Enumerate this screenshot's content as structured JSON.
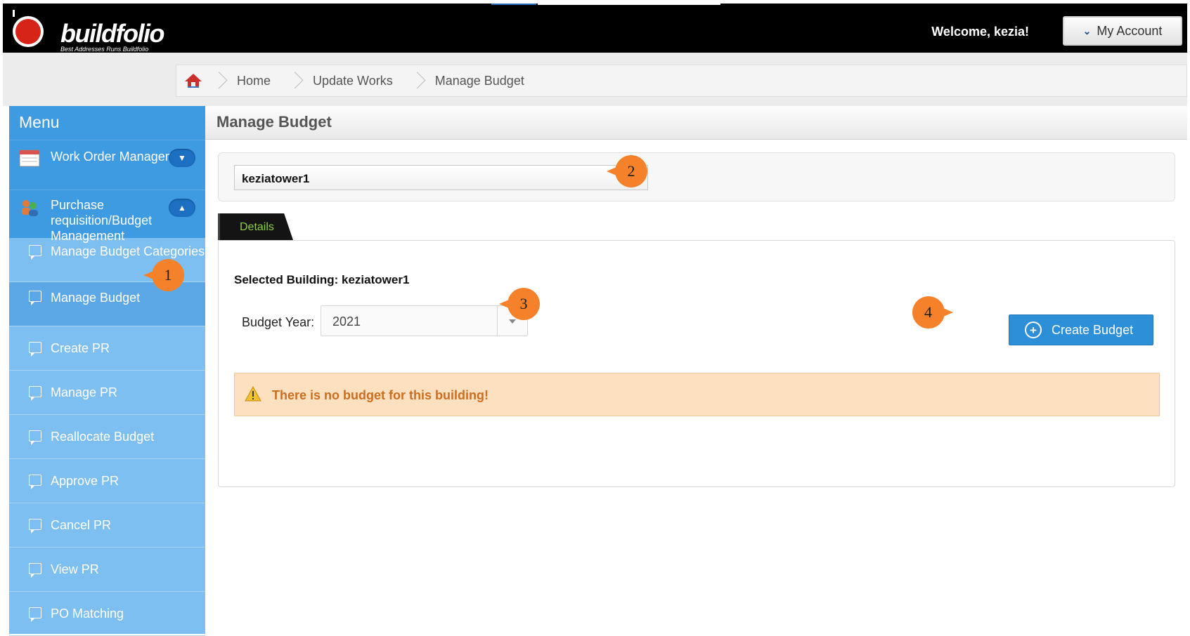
{
  "header": {
    "brand": "buildfolio",
    "tagline": "Best Addresses Runs Buildfolio",
    "welcome": "Welcome, kezia!",
    "account_button": "My Account"
  },
  "breadcrumb": {
    "items": [
      "Home",
      "Update Works",
      "Manage Budget"
    ]
  },
  "sidebar": {
    "title": "Menu",
    "groups": [
      {
        "label": "Work Order Management",
        "expanded": false
      },
      {
        "label": "Purchase requisition/Budget Management",
        "expanded": true
      }
    ],
    "items": [
      {
        "label": "Manage Budget Categories"
      },
      {
        "label": "Manage Budget",
        "active": true
      },
      {
        "label": "Create PR"
      },
      {
        "label": "Manage PR"
      },
      {
        "label": "Reallocate Budget"
      },
      {
        "label": "Approve PR"
      },
      {
        "label": "Cancel PR"
      },
      {
        "label": "View PR"
      },
      {
        "label": "PO Matching"
      }
    ]
  },
  "main": {
    "title": "Manage Budget",
    "building_select": {
      "value": "keziatower1"
    },
    "tab": {
      "label": "Details"
    },
    "selected_building_label": "Selected Building: keziatower1",
    "budget_year": {
      "label": "Budget Year:",
      "value": "2021"
    },
    "create_button": "Create Budget",
    "alert": "There is no budget for this building!"
  },
  "callouts": [
    "1",
    "2",
    "3",
    "4"
  ],
  "colors": {
    "accent": "#3e9be2",
    "sidebar": "#7ebff2",
    "callout": "#f5822a",
    "alert_bg": "#fde0c0",
    "alert_text": "#cc6d1f",
    "tab_text": "#8bd23a"
  }
}
